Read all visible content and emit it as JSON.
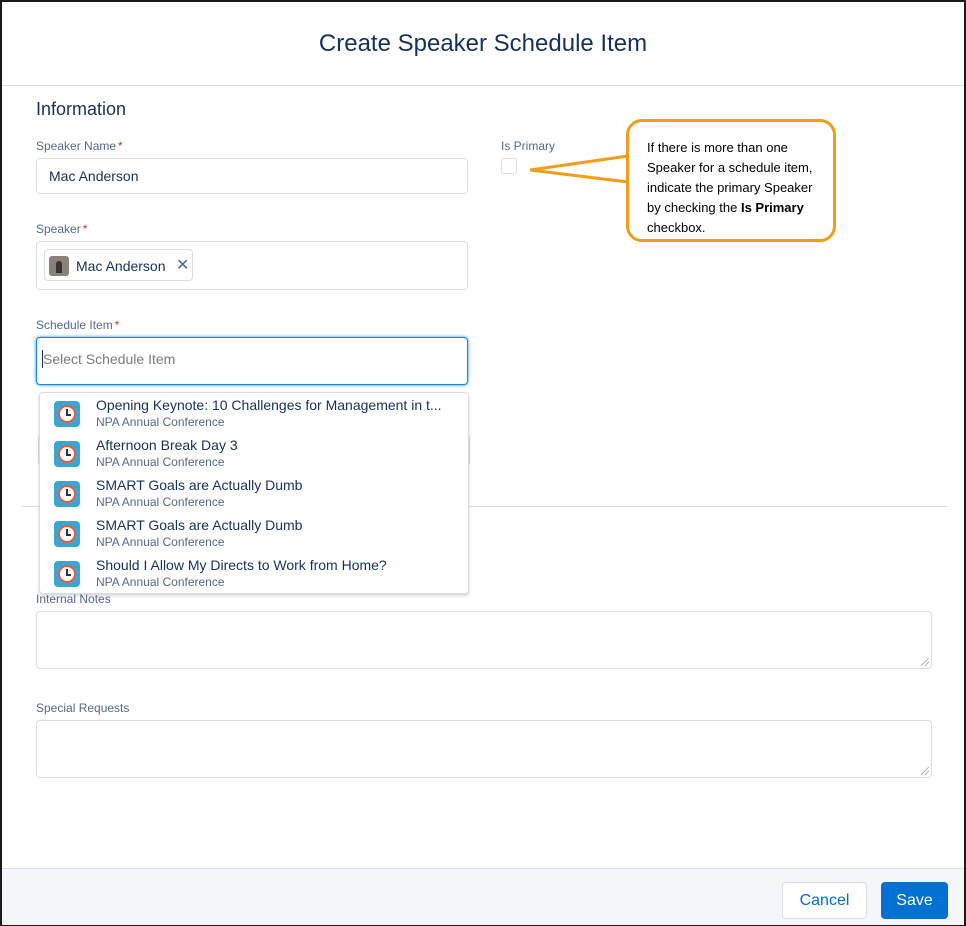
{
  "modal": {
    "title": "Create Speaker Schedule Item",
    "section_title": "Information"
  },
  "fields": {
    "speaker_name": {
      "label": "Speaker Name",
      "required": "*",
      "value": "Mac Anderson"
    },
    "speaker": {
      "label": "Speaker",
      "required": "*",
      "pill_value": "Mac Anderson",
      "remove_glyph": "✕"
    },
    "schedule_item": {
      "label": "Schedule Item",
      "required": "*",
      "placeholder": "Select Schedule Item"
    },
    "is_primary": {
      "label": "Is Primary",
      "checked": false
    },
    "internal_notes": {
      "label": "Internal Notes",
      "value": ""
    },
    "special_requests": {
      "label": "Special Requests",
      "value": ""
    }
  },
  "dropdown": {
    "items": [
      {
        "title": "Opening Keynote: 10 Challenges for Management in t...",
        "subtitle": "NPA Annual Conference",
        "icon": "clock-icon"
      },
      {
        "title": "Afternoon Break Day 3",
        "subtitle": "NPA Annual Conference",
        "icon": "clock-icon"
      },
      {
        "title": "SMART Goals are Actually Dumb",
        "subtitle": "NPA Annual Conference",
        "icon": "clock-icon"
      },
      {
        "title": "SMART Goals are Actually Dumb",
        "subtitle": "NPA Annual Conference",
        "icon": "clock-icon"
      },
      {
        "title": "Should I Allow My Directs to Work from Home?",
        "subtitle": "NPA Annual Conference",
        "icon": "clock-icon"
      }
    ]
  },
  "callout": {
    "text_before": "If there is more than one Speaker for a schedule item, indicate the primary Speaker by checking the ",
    "text_bold": "Is Primary",
    "text_after": " checkbox.",
    "border_color": "#f39c17"
  },
  "footer": {
    "cancel_label": "Cancel",
    "save_label": "Save"
  },
  "colors": {
    "brand": "#0070d2",
    "text": "#16325c",
    "label": "#54698d",
    "required": "#c23934",
    "focus": "#1589ee"
  }
}
